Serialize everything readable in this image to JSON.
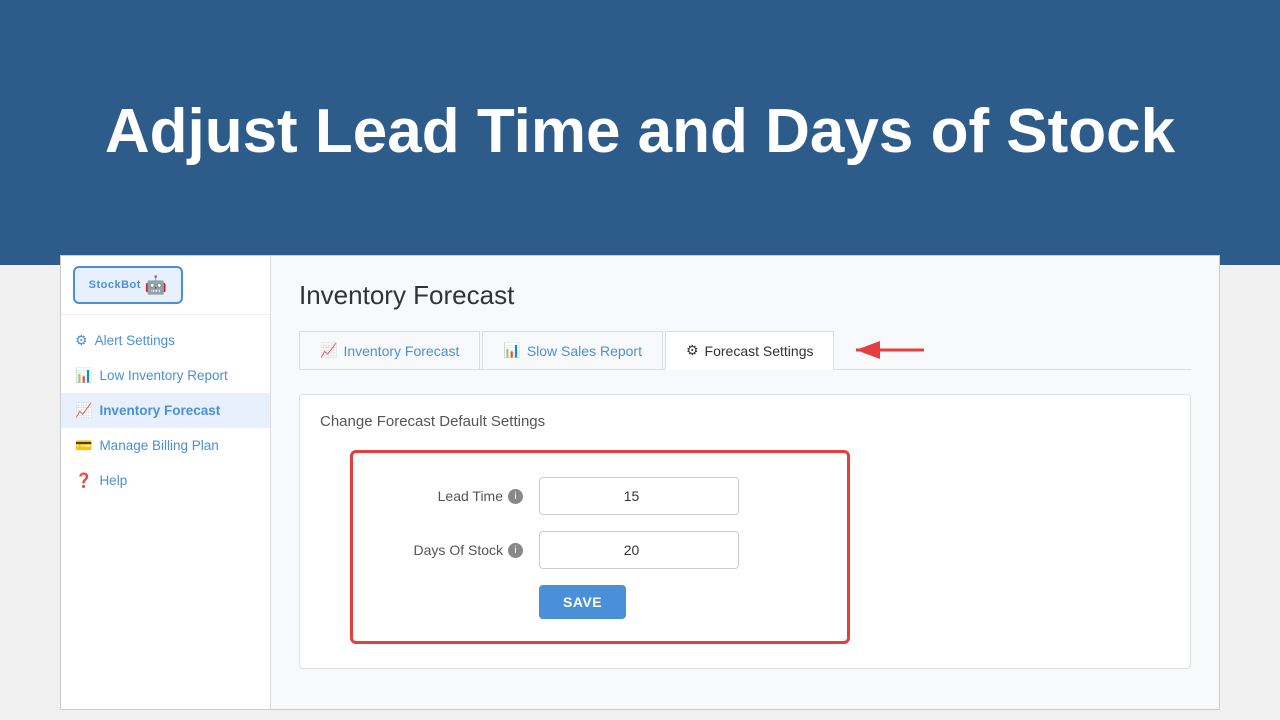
{
  "hero": {
    "title": "Adjust Lead Time and Days of Stock"
  },
  "sidebar": {
    "logo_text": "StockBot",
    "items": [
      {
        "id": "alert-settings",
        "label": "Alert Settings",
        "icon": "⚙",
        "active": false
      },
      {
        "id": "low-inventory",
        "label": "Low Inventory Report",
        "icon": "📊",
        "active": false
      },
      {
        "id": "inventory-forecast",
        "label": "Inventory Forecast",
        "icon": "📈",
        "active": true
      },
      {
        "id": "manage-billing",
        "label": "Manage Billing Plan",
        "icon": "💳",
        "active": false
      },
      {
        "id": "help",
        "label": "Help",
        "icon": "❓",
        "active": false
      }
    ]
  },
  "main": {
    "page_title": "Inventory Forecast",
    "tabs": [
      {
        "id": "inventory-forecast-tab",
        "label": "Inventory Forecast",
        "icon": "📈",
        "active": false
      },
      {
        "id": "slow-sales-tab",
        "label": "Slow Sales Report",
        "icon": "📊",
        "active": false
      },
      {
        "id": "forecast-settings-tab",
        "label": "Forecast Settings",
        "icon": "⚙",
        "active": true
      }
    ],
    "panel": {
      "title": "Change Forecast Default Settings",
      "lead_time_label": "Lead Time",
      "lead_time_value": "15",
      "days_of_stock_label": "Days Of Stock",
      "days_of_stock_value": "20",
      "save_label": "SAVE"
    }
  }
}
